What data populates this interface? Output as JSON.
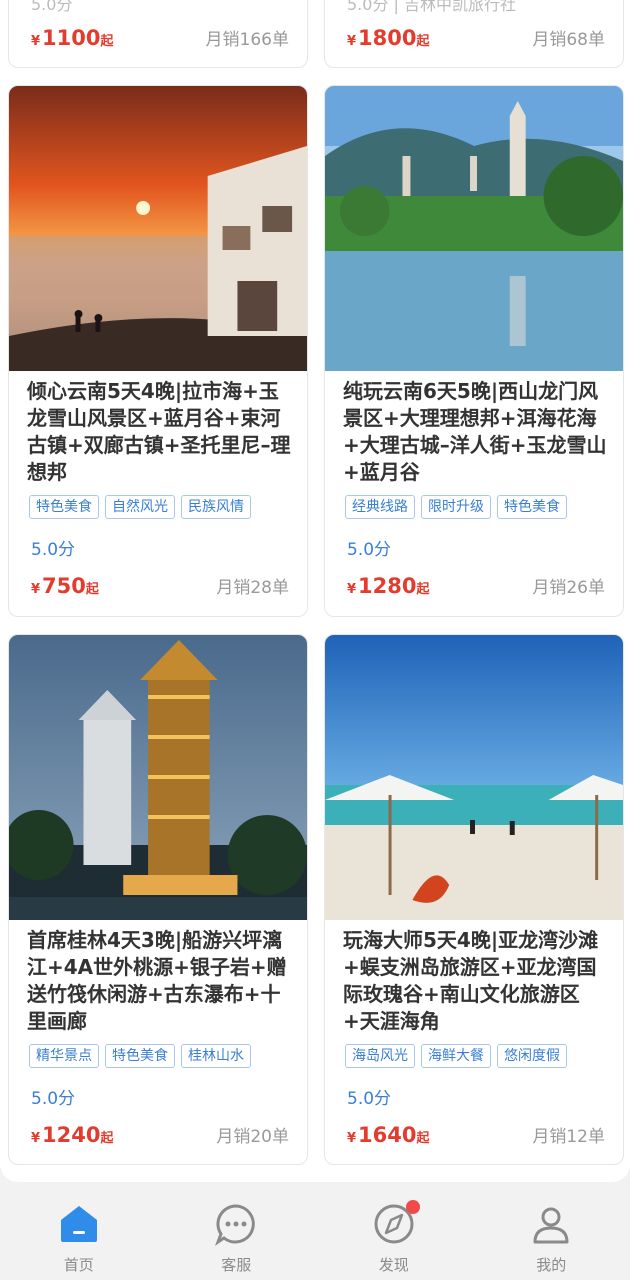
{
  "top_cards": [
    {
      "cut_text": "5.0分",
      "price_symbol": "¥",
      "price": "1100",
      "price_unit": "起",
      "sales": "月销166单"
    },
    {
      "cut_text": "5.0分 | 吉林中凯旅行社",
      "price_symbol": "¥",
      "price": "1800",
      "price_unit": "起",
      "sales": "月销68单"
    }
  ],
  "cards": [
    {
      "title": "倾心云南5天4晚|拉市海+玉龙雪山风景区+蓝月谷+束河古镇+双廊古镇+圣托里尼–理想邦",
      "tags": [
        "特色美食",
        "自然风光",
        "民族风情"
      ],
      "score": "5.0分",
      "price_symbol": "¥",
      "price": "750",
      "price_unit": "起",
      "sales": "月销28单",
      "photo": "sunset-seaside-photo"
    },
    {
      "title": "纯玩云南6天5晚|西山龙门风景区+大理理想邦+洱海花海+大理古城–洋人街+玉龙雪山+蓝月谷",
      "tags": [
        "经典线路",
        "限时升级",
        "特色美食"
      ],
      "score": "5.0分",
      "price_symbol": "¥",
      "price": "1280",
      "price_unit": "起",
      "sales": "月销26单",
      "photo": "three-pagodas-photo"
    },
    {
      "title": "首席桂林4天3晚|船游兴坪漓江+4A世外桃源+银子岩+赠送竹筏休闲游+古东瀑布+十里画廊",
      "tags": [
        "精华景点",
        "特色美食",
        "桂林山水"
      ],
      "score": "5.0分",
      "price_symbol": "¥",
      "price": "1240",
      "price_unit": "起",
      "sales": "月销20单",
      "photo": "sun-moon-pagodas-photo"
    },
    {
      "title": "玩海大师5天4晚|亚龙湾沙滩+蜈支洲岛旅游区+亚龙湾国际玫瑰谷+南山文化旅游区+天涯海角",
      "tags": [
        "海岛风光",
        "海鲜大餐",
        "悠闲度假"
      ],
      "score": "5.0分",
      "price_symbol": "¥",
      "price": "1640",
      "price_unit": "起",
      "sales": "月销12单",
      "photo": "beach-umbrella-photo"
    }
  ],
  "tabbar": [
    {
      "label": "首页",
      "icon": "home-icon",
      "active": true
    },
    {
      "label": "客服",
      "icon": "chat-icon",
      "active": false
    },
    {
      "label": "发现",
      "icon": "compass-icon",
      "active": false,
      "badge": true
    },
    {
      "label": "我的",
      "icon": "user-icon",
      "active": false
    }
  ],
  "colors": {
    "accent": "#2f8ce8",
    "price": "#e33c2e",
    "tag": "#3a7fd5",
    "badge": "#f04a4a"
  }
}
